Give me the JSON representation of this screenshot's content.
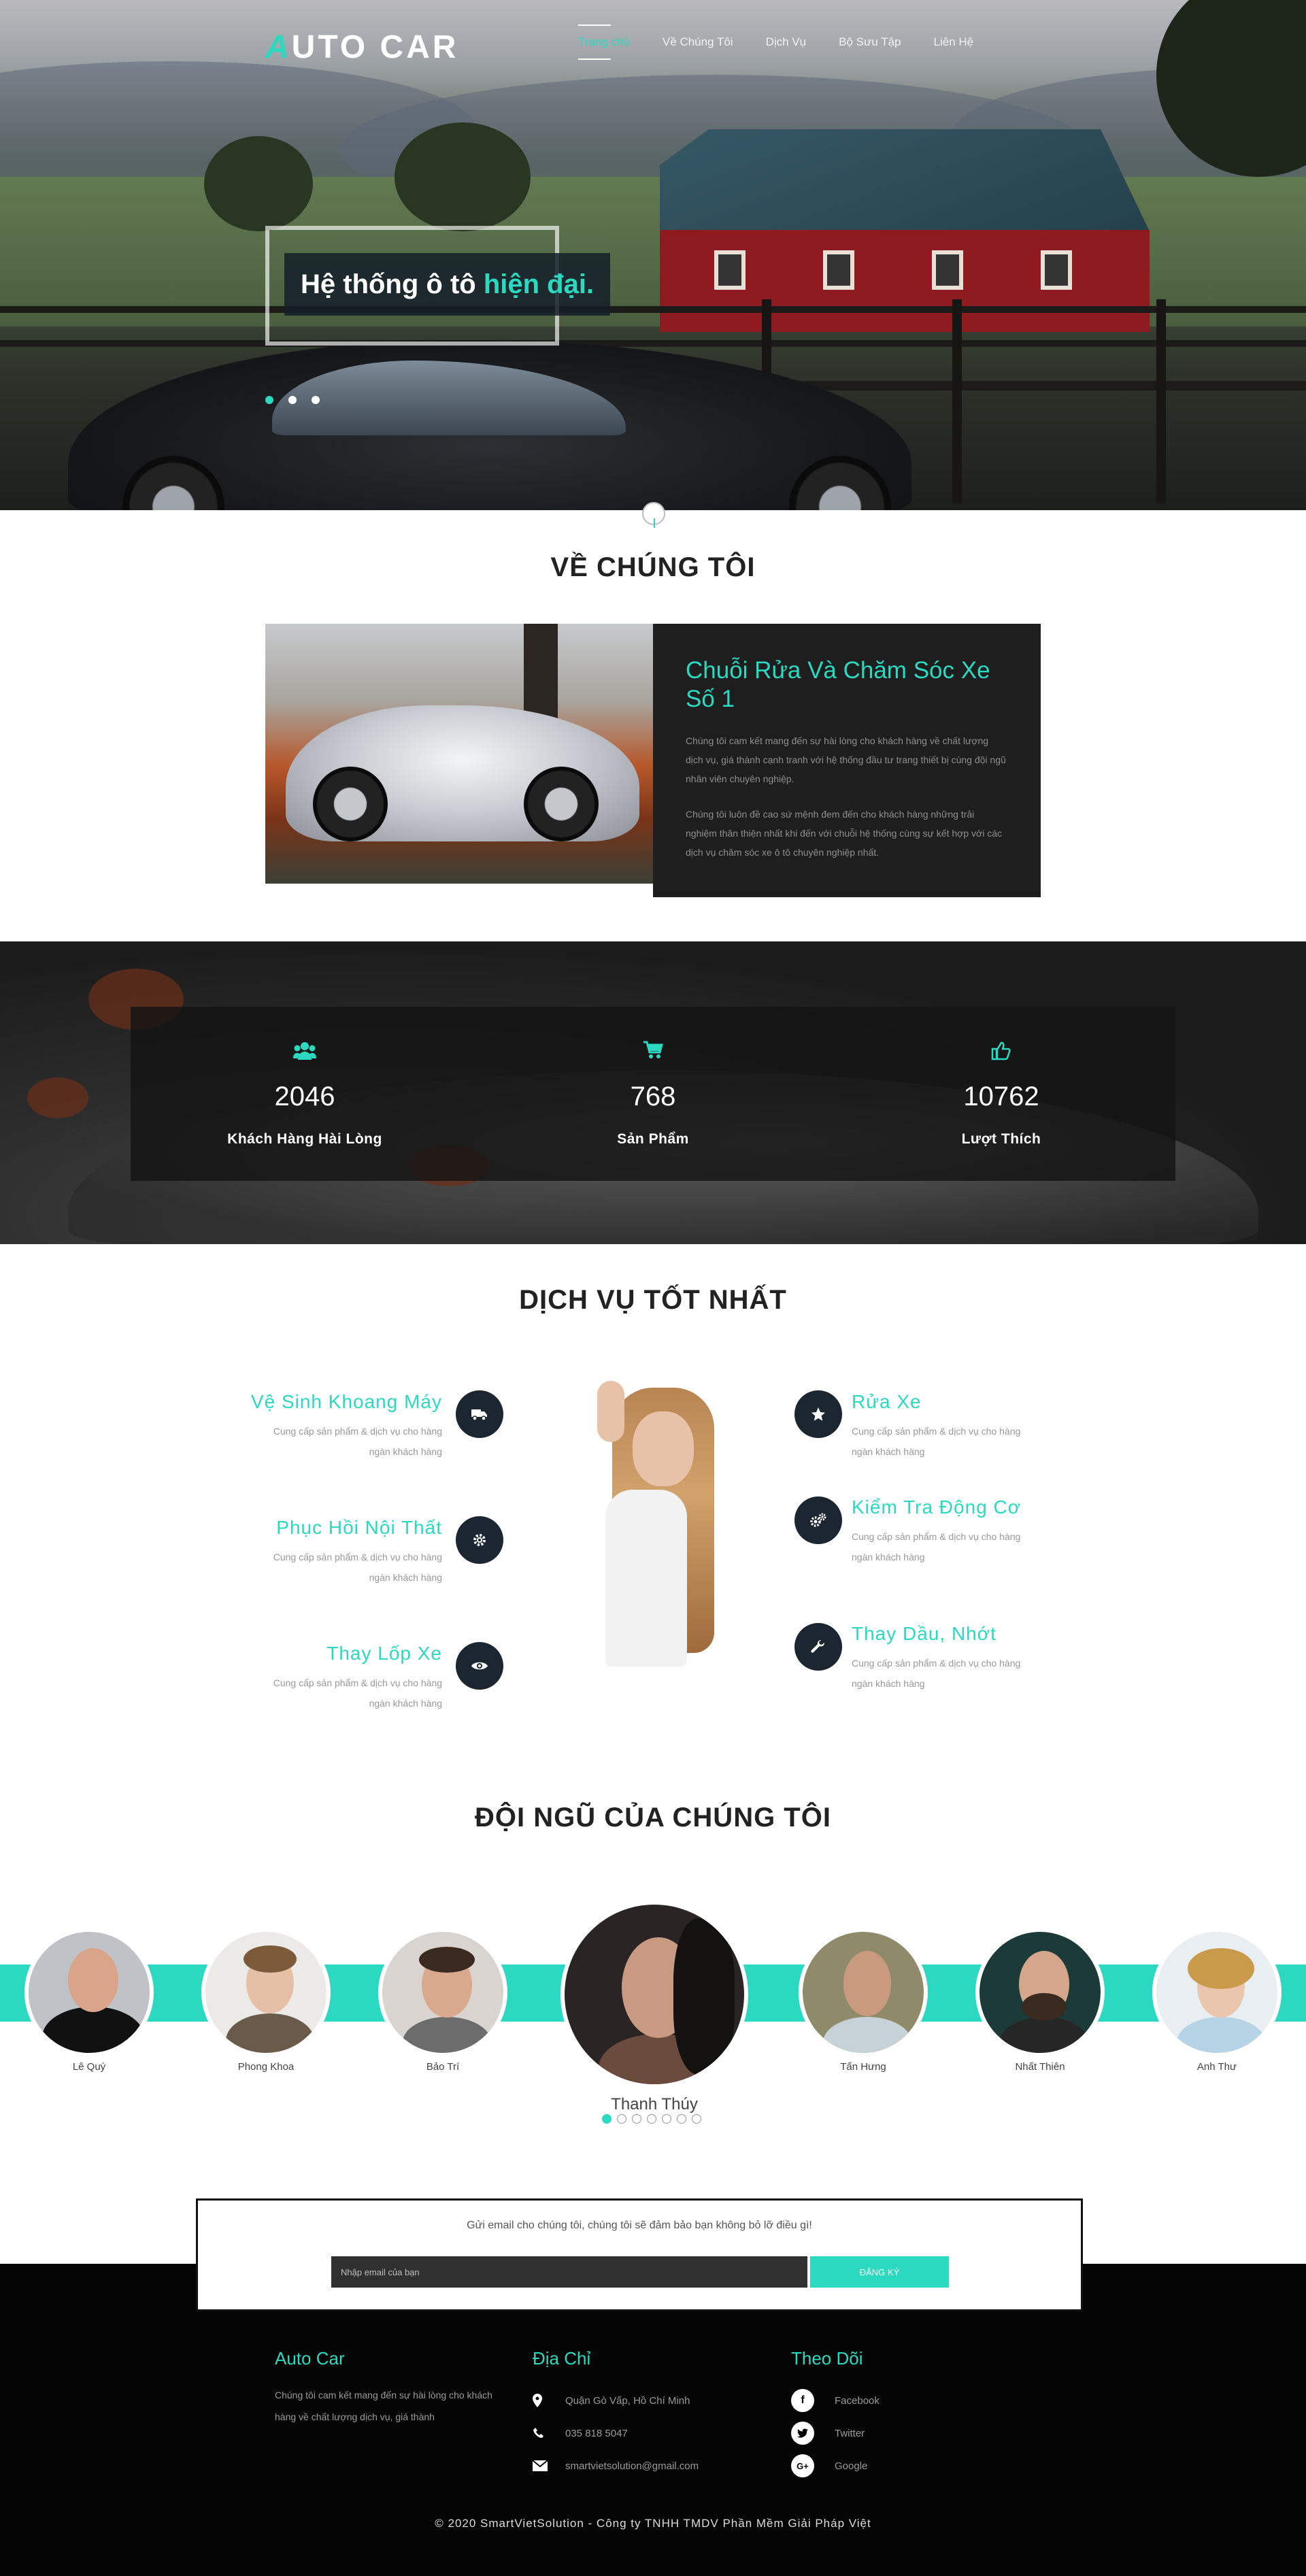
{
  "brand": {
    "logo_first": "A",
    "logo_rest": "UTO CAR",
    "accent": "#2ad9c0"
  },
  "nav": {
    "items": [
      "Trang chủ",
      "Về Chúng Tôi",
      "Dịch Vụ",
      "Bộ Sưu Tập",
      "Liên Hệ"
    ],
    "active_index": 0
  },
  "hero": {
    "caption_prefix": "Hệ thống ô tô",
    "caption_highlight": "hiện đại.",
    "slides": 3,
    "active_slide": 0
  },
  "about": {
    "title": "VỀ CHÚNG TÔI",
    "heading": "Chuỗi Rửa Và Chăm Sóc Xe Số 1",
    "para1": "Chúng tôi cam kết mang đến sự hài lòng cho khách hàng về chất lượng dịch vụ, giá thành cạnh tranh với hệ thống đầu tư trang thiết bị cùng đội ngũ nhân viên chuyên nghiệp.",
    "para2": "Chúng tôi luôn đề cao sứ mệnh đem đến cho khách hàng những trải nghiệm thân thiện nhất khi đến với chuỗi hệ thống cùng sự kết hợp với các dịch vụ chăm sóc xe ô tô chuyên nghiệp nhất."
  },
  "stats": [
    {
      "icon": "users-icon",
      "value": "2046",
      "label": "Khách Hàng Hài Lòng"
    },
    {
      "icon": "cart-icon",
      "value": "768",
      "label": "Sản Phẩm"
    },
    {
      "icon": "thumbs-up-icon",
      "value": "10762",
      "label": "Lượt Thích"
    }
  ],
  "services": {
    "title": "DỊCH VỤ TỐT NHẤT",
    "left": [
      {
        "title": "Vệ Sinh Khoang Máy",
        "desc": "Cung cấp sản phẩm & dịch vụ cho hàng ngàn khách hàng",
        "icon": "truck-icon"
      },
      {
        "title": "Phục Hồi Nội Thất",
        "desc": "Cung cấp sản phẩm & dịch vụ cho hàng ngàn khách hàng",
        "icon": "gear-icon"
      },
      {
        "title": "Thay Lốp Xe",
        "desc": "Cung cấp sản phẩm & dịch vụ cho hàng ngàn khách hàng",
        "icon": "eye-icon"
      }
    ],
    "right": [
      {
        "title": "Rửa Xe",
        "desc": "Cung cấp sản phẩm & dịch vụ cho hàng ngàn khách hàng",
        "icon": "star-icon"
      },
      {
        "title": "Kiểm Tra Động Cơ",
        "desc": "Cung cấp sản phẩm & dịch vụ cho hàng ngàn khách hàng",
        "icon": "gears-icon"
      },
      {
        "title": "Thay Dầu, Nhớt",
        "desc": "Cung cấp sản phẩm & dịch vụ cho hàng ngàn khách hàng",
        "icon": "wrench-icon"
      }
    ]
  },
  "team": {
    "title": "ĐỘI NGŨ CỦA CHÚNG TÔI",
    "members": [
      "Lê Quý",
      "Phong Khoa",
      "Bảo Trí",
      "Thanh Thúy",
      "Tấn Hưng",
      "Nhất Thiên",
      "Anh Thư"
    ],
    "featured_index": 3,
    "pages": 7,
    "active_page": 0
  },
  "newsletter": {
    "message": "Gửi email cho chúng tôi, chúng tôi sẽ đảm bảo bạn không bỏ lỡ điều gì!",
    "placeholder": "Nhập email của bạn",
    "button": "ĐĂNG KÝ"
  },
  "footer": {
    "about_title": "Auto Car",
    "about_text": "Chúng tôi cam kết mang đến sự hài lòng cho khách hàng về chất lượng dịch vụ, giá thành",
    "address_title": "Địa Chỉ",
    "address": "Quận Gò Vấp, Hồ Chí Minh",
    "phone": "035 818 5047",
    "email": "smartvietsolution@gmail.com",
    "follow_title": "Theo Dõi",
    "social": [
      {
        "letter": "f",
        "label": "Facebook",
        "icon": "facebook-icon"
      },
      {
        "letter": "t",
        "label": "Twitter",
        "icon": "twitter-icon"
      },
      {
        "letter": "G+",
        "label": "Google",
        "icon": "google-plus-icon"
      }
    ],
    "copyright": "© 2020 SmartVietSolution - Công ty TNHH TMDV Phần Mềm Giải Pháp Việt"
  }
}
